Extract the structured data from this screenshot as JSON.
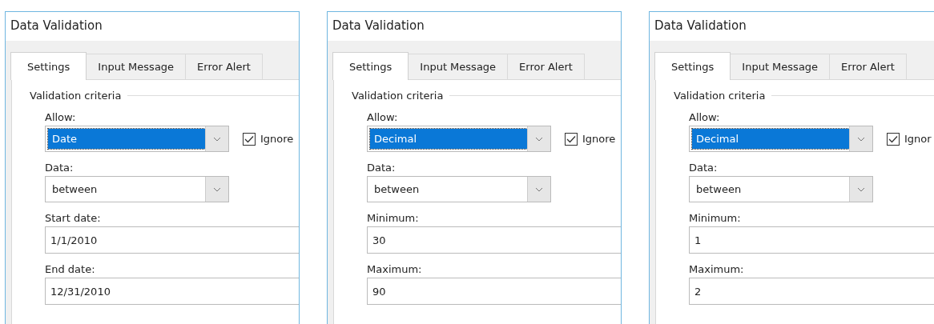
{
  "dialogs": [
    {
      "window": {
        "title": "Data Validation"
      },
      "tabs": [
        {
          "label": "Settings",
          "selected": true
        },
        {
          "label": "Input Message",
          "selected": false
        },
        {
          "label": "Error Alert",
          "selected": false
        }
      ],
      "group_label": "Validation criteria",
      "allow": {
        "label": "Allow:",
        "value": "Date",
        "ignore_blank": {
          "label": "Ignore",
          "checked": true
        }
      },
      "data": {
        "label": "Data:",
        "value": "between"
      },
      "fields": [
        {
          "label": "Start date:",
          "value": "1/1/2010"
        },
        {
          "label": "End date:",
          "value": "12/31/2010"
        }
      ]
    },
    {
      "window": {
        "title": "Data Validation"
      },
      "tabs": [
        {
          "label": "Settings",
          "selected": true
        },
        {
          "label": "Input Message",
          "selected": false
        },
        {
          "label": "Error Alert",
          "selected": false
        }
      ],
      "group_label": "Validation criteria",
      "allow": {
        "label": "Allow:",
        "value": "Decimal",
        "ignore_blank": {
          "label": "Ignore",
          "checked": true
        }
      },
      "data": {
        "label": "Data:",
        "value": "between"
      },
      "fields": [
        {
          "label": "Minimum:",
          "value": "30"
        },
        {
          "label": "Maximum:",
          "value": "90"
        }
      ]
    },
    {
      "window": {
        "title": "Data Validation"
      },
      "tabs": [
        {
          "label": "Settings",
          "selected": true
        },
        {
          "label": "Input Message",
          "selected": false
        },
        {
          "label": "Error Alert",
          "selected": false
        }
      ],
      "group_label": "Validation criteria",
      "allow": {
        "label": "Allow:",
        "value": "Decimal",
        "ignore_blank": {
          "label": "Ignor",
          "checked": true
        }
      },
      "data": {
        "label": "Data:",
        "value": "between"
      },
      "fields": [
        {
          "label": "Minimum:",
          "value": "1"
        },
        {
          "label": "Maximum:",
          "value": "2"
        }
      ]
    }
  ]
}
